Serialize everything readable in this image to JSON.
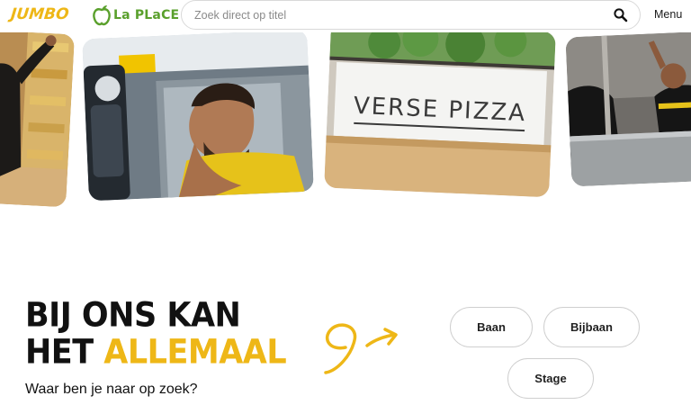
{
  "header": {
    "logo_jumbo": "JUMBO",
    "logo_laplace": "La PLaCE",
    "search_placeholder": "Zoek direct op titel",
    "search_icon": "search-icon",
    "menu_label": "Menu"
  },
  "photos": [
    {
      "name": "employee-in-store-photo"
    },
    {
      "name": "driver-in-truck-photo"
    },
    {
      "name": "verse-pizza-counter-photo",
      "sign_text": "VERSE PIZZA"
    },
    {
      "name": "employees-waving-photo"
    }
  ],
  "hero": {
    "headline_line1": "BIJ ONS KAN",
    "headline_line2_dark": "HET",
    "headline_line2_accent": "ALLEMAAL",
    "subhead": "Waar ben je naar op zoek?",
    "options": [
      "Baan",
      "Bijbaan",
      "Stage"
    ]
  },
  "colors": {
    "accent_yellow": "#eeb717",
    "laplace_green": "#5aa02c",
    "text_dark": "#111111"
  }
}
